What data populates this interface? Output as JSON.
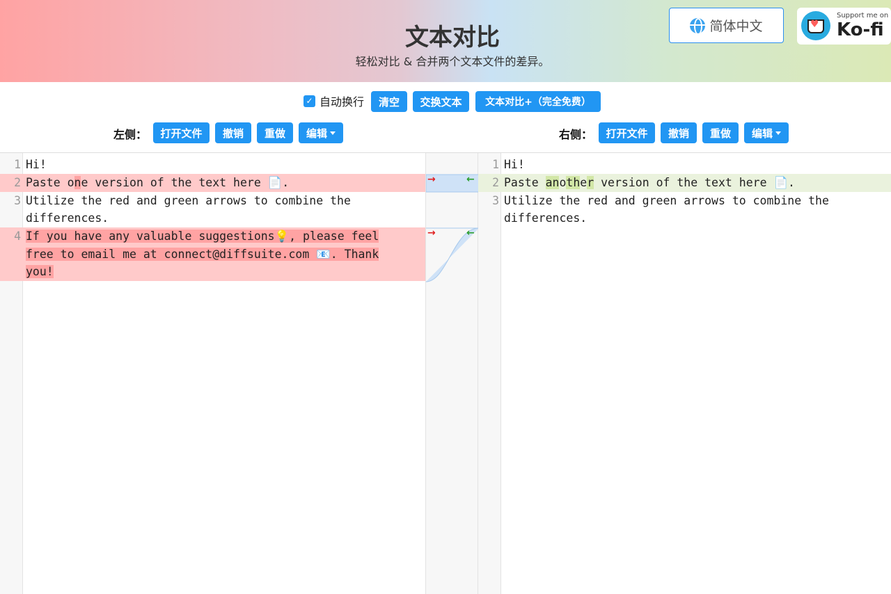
{
  "header": {
    "title": "文本对比",
    "subtitle": "轻松对比 & 合并两个文本文件的差异。",
    "language_button": "简体中文",
    "kofi_small": "Support me on",
    "kofi_big": "Ko-fi"
  },
  "toolbar": {
    "wrap_label": "自动换行",
    "clear_label": "清空",
    "swap_label": "交换文本",
    "pro_label": "文本对比+（完全免费）"
  },
  "left_bar": {
    "label": "左侧：",
    "open_label": "打开文件",
    "undo_label": "撤销",
    "redo_label": "重做",
    "edit_label": "编辑"
  },
  "right_bar": {
    "label": "右侧：",
    "open_label": "打开文件",
    "undo_label": "撤销",
    "redo_label": "重做",
    "edit_label": "编辑"
  },
  "left_editor": {
    "l1_num": "1",
    "l1_text": "Hi!",
    "l2_num": "2",
    "l2_pre": "Paste o",
    "l2_hl": "n",
    "l2_post": "e version of the text here 📄.",
    "l3_num": "3",
    "l3_a": "Utilize the red and green arrows to combine the",
    "l3_b": "differences.",
    "l4_num": "4",
    "l4_a": "If you have any valuable suggestions💡, please feel",
    "l4_b": "free to email me at connect@diffsuite.com 📧. Thank",
    "l4_c": "you!"
  },
  "right_editor": {
    "l1_num": "1",
    "l1_text": "Hi!",
    "l2_num": "2",
    "l2_pre": "Paste ",
    "l2_hl1": "an",
    "l2_mid1": "o",
    "l2_hl2": "th",
    "l2_mid2": "e",
    "l2_hl3": "r",
    "l2_post": " version of the text here 📄.",
    "l3_num": "3",
    "l3_a": "Utilize the red and green arrows to combine the",
    "l3_b": "differences."
  },
  "merge": {
    "to_right": "→",
    "to_left": "←"
  }
}
